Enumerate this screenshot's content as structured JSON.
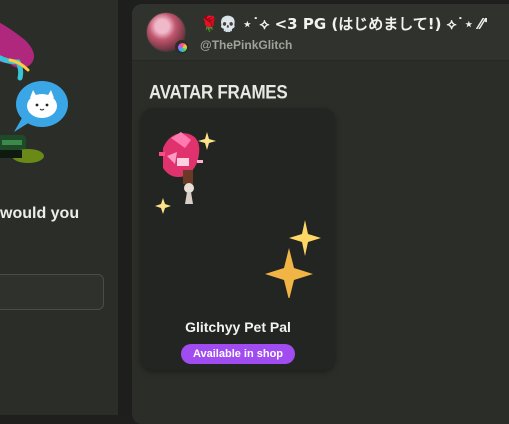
{
  "left_panel": {
    "question_fragment": "would you"
  },
  "profile": {
    "display_name": "🌹💀 ⋆˙⟡ <3 PG (はじめまして!) ⟡˙⋆ ⁄⁄'",
    "username": "@ThePinkGlitch"
  },
  "section": {
    "title": "Avatar Frames"
  },
  "items": [
    {
      "name": "Glitchyy Pet Pal",
      "status": "Available in shop"
    }
  ],
  "colors": {
    "badge": "#a14cf0",
    "card_bg": "#232522",
    "panel_bg": "#2b2d29"
  },
  "icons": {
    "avatar_badge": "nitro-badge-icon",
    "frame": "pet-pal-frame-art"
  }
}
